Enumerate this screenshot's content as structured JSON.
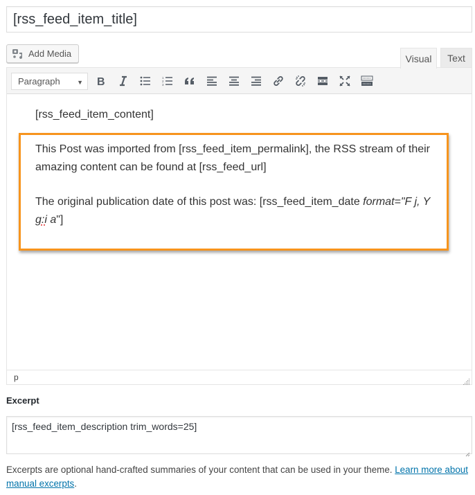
{
  "title_input": {
    "value": "[rss_feed_item_title]"
  },
  "media": {
    "add_media_label": "Add Media"
  },
  "tabs": [
    {
      "label": "Visual",
      "active": true
    },
    {
      "label": "Text",
      "active": false
    }
  ],
  "toolbar": {
    "format_select": "Paragraph",
    "buttons": [
      {
        "name": "bold",
        "icon": "bold-icon"
      },
      {
        "name": "italic",
        "icon": "italic-icon"
      },
      {
        "name": "bulleted-list",
        "icon": "bulleted-list-icon"
      },
      {
        "name": "numbered-list",
        "icon": "numbered-list-icon"
      },
      {
        "name": "blockquote",
        "icon": "blockquote-icon"
      },
      {
        "name": "align-left",
        "icon": "align-left-icon"
      },
      {
        "name": "align-center",
        "icon": "align-center-icon"
      },
      {
        "name": "align-right",
        "icon": "align-right-icon"
      },
      {
        "name": "insert-link",
        "icon": "link-icon"
      },
      {
        "name": "remove-link",
        "icon": "unlink-icon"
      },
      {
        "name": "read-more",
        "icon": "read-more-icon"
      },
      {
        "name": "fullscreen",
        "icon": "fullscreen-icon"
      },
      {
        "name": "toolbar-toggle",
        "icon": "keyboard-icon"
      }
    ]
  },
  "editor": {
    "shortcode_paragraph": "[rss_feed_item_content]",
    "import_paragraph": "This Post was imported from [rss_feed_item_permalink], the RSS stream of their amazing content can be found at [rss_feed_url]",
    "date_paragraph": {
      "prefix": "The original publication date of this post was: [rss_feed_item_date ",
      "italic_part_1": "format=\"F j, Y ",
      "italic_misspelled": "g:i",
      "italic_part_2": " a",
      "suffix": "\"]"
    },
    "highlight_color": "#f7941d"
  },
  "statusbar": {
    "path": "p"
  },
  "excerpt": {
    "label": "Excerpt",
    "value": "[rss_feed_item_description trim_words=25]",
    "help_text": "Excerpts are optional hand-crafted summaries of your content that can be used in your theme. ",
    "help_link": "Learn more about manual excerpts",
    "help_end": "."
  },
  "colors": {
    "link": "#0073aa",
    "toolbar_bg": "#f5f5f5",
    "icon": "#555d66"
  }
}
